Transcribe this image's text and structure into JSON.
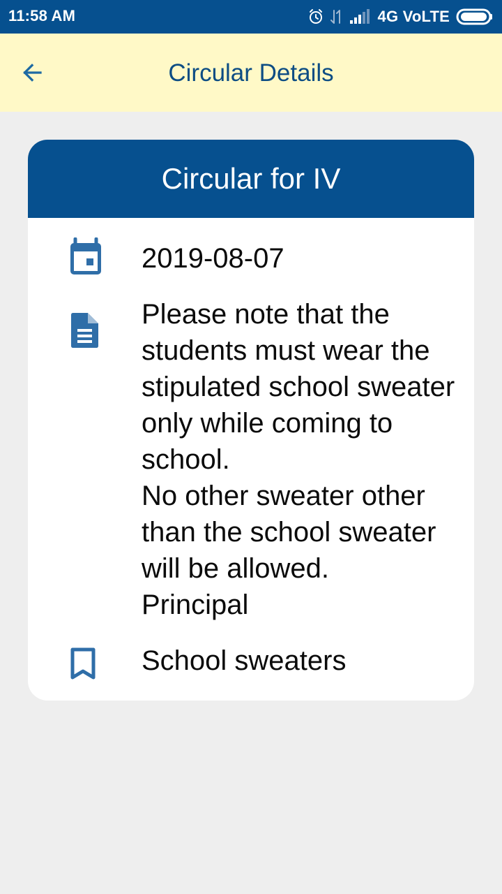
{
  "status_bar": {
    "time": "11:58 AM",
    "network": "4G VoLTE",
    "icons": [
      "alarm-icon",
      "data-transfer-icon",
      "signal-icon",
      "battery-icon"
    ]
  },
  "app_bar": {
    "title": "Circular Details",
    "back_icon": "arrow-left-icon"
  },
  "circular": {
    "title": "Circular for IV",
    "date": "2019-08-07",
    "description": "Please note that the students must wear the stipulated school sweater only while coming to school.\nNo other sweater other than the school sweater will be allowed.\nPrincipal",
    "subject": "School sweaters",
    "icons": {
      "date": "calendar-icon",
      "description": "document-icon",
      "subject": "bookmark-icon"
    }
  },
  "colors": {
    "primary": "#06508f",
    "app_bar_background": "#fff9c7",
    "app_bar_text": "#0d4d84",
    "icon": "#2f6ea8",
    "page_background": "#eeeeee"
  }
}
